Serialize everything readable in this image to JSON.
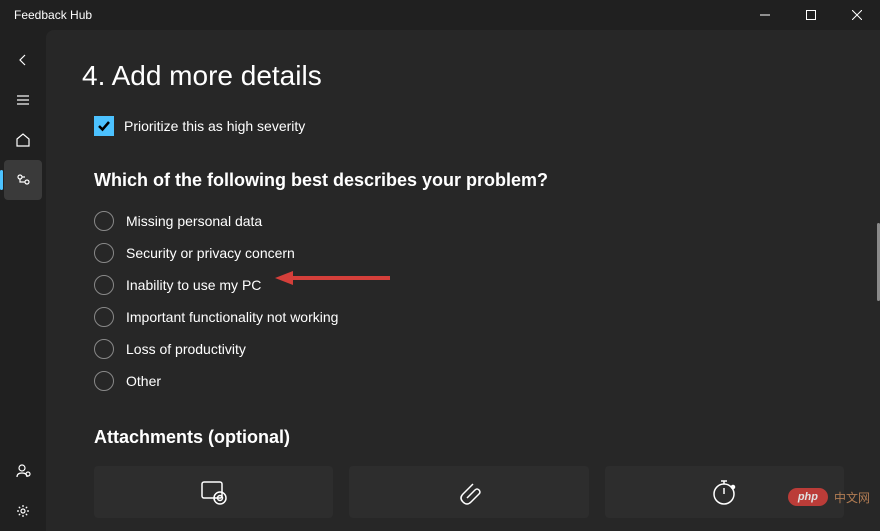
{
  "window": {
    "title": "Feedback Hub"
  },
  "colors": {
    "accent": "#4cc2ff",
    "annotation": "#d43f3a"
  },
  "section": {
    "title": "4. Add more details",
    "priority_checkbox": {
      "label": "Prioritize this as high severity",
      "checked": true
    },
    "question": "Which of the following best describes your problem?",
    "options": [
      "Missing personal data",
      "Security or privacy concern",
      "Inability to use my PC",
      "Important functionality not working",
      "Loss of productivity",
      "Other"
    ],
    "attachments_title": "Attachments (optional)"
  },
  "watermark": {
    "badge": "php",
    "text": "中文网"
  }
}
